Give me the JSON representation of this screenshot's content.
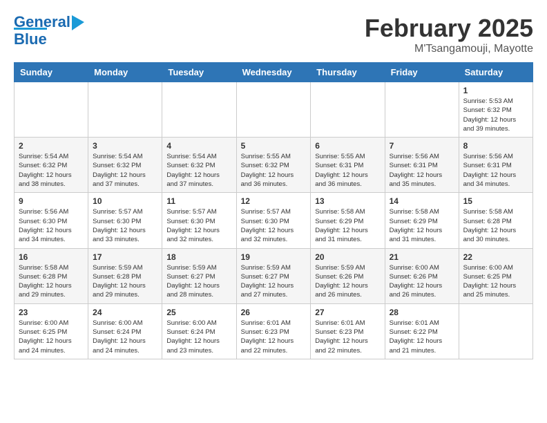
{
  "header": {
    "logo_line1": "General",
    "logo_line2": "Blue",
    "month": "February 2025",
    "location": "M'Tsangamouji, Mayotte"
  },
  "days_of_week": [
    "Sunday",
    "Monday",
    "Tuesday",
    "Wednesday",
    "Thursday",
    "Friday",
    "Saturday"
  ],
  "weeks": [
    {
      "days": [
        {
          "number": "",
          "info": ""
        },
        {
          "number": "",
          "info": ""
        },
        {
          "number": "",
          "info": ""
        },
        {
          "number": "",
          "info": ""
        },
        {
          "number": "",
          "info": ""
        },
        {
          "number": "",
          "info": ""
        },
        {
          "number": "1",
          "info": "Sunrise: 5:53 AM\nSunset: 6:32 PM\nDaylight: 12 hours and 39 minutes."
        }
      ]
    },
    {
      "days": [
        {
          "number": "2",
          "info": "Sunrise: 5:54 AM\nSunset: 6:32 PM\nDaylight: 12 hours and 38 minutes."
        },
        {
          "number": "3",
          "info": "Sunrise: 5:54 AM\nSunset: 6:32 PM\nDaylight: 12 hours and 37 minutes."
        },
        {
          "number": "4",
          "info": "Sunrise: 5:54 AM\nSunset: 6:32 PM\nDaylight: 12 hours and 37 minutes."
        },
        {
          "number": "5",
          "info": "Sunrise: 5:55 AM\nSunset: 6:32 PM\nDaylight: 12 hours and 36 minutes."
        },
        {
          "number": "6",
          "info": "Sunrise: 5:55 AM\nSunset: 6:31 PM\nDaylight: 12 hours and 36 minutes."
        },
        {
          "number": "7",
          "info": "Sunrise: 5:56 AM\nSunset: 6:31 PM\nDaylight: 12 hours and 35 minutes."
        },
        {
          "number": "8",
          "info": "Sunrise: 5:56 AM\nSunset: 6:31 PM\nDaylight: 12 hours and 34 minutes."
        }
      ]
    },
    {
      "days": [
        {
          "number": "9",
          "info": "Sunrise: 5:56 AM\nSunset: 6:30 PM\nDaylight: 12 hours and 34 minutes."
        },
        {
          "number": "10",
          "info": "Sunrise: 5:57 AM\nSunset: 6:30 PM\nDaylight: 12 hours and 33 minutes."
        },
        {
          "number": "11",
          "info": "Sunrise: 5:57 AM\nSunset: 6:30 PM\nDaylight: 12 hours and 32 minutes."
        },
        {
          "number": "12",
          "info": "Sunrise: 5:57 AM\nSunset: 6:30 PM\nDaylight: 12 hours and 32 minutes."
        },
        {
          "number": "13",
          "info": "Sunrise: 5:58 AM\nSunset: 6:29 PM\nDaylight: 12 hours and 31 minutes."
        },
        {
          "number": "14",
          "info": "Sunrise: 5:58 AM\nSunset: 6:29 PM\nDaylight: 12 hours and 31 minutes."
        },
        {
          "number": "15",
          "info": "Sunrise: 5:58 AM\nSunset: 6:28 PM\nDaylight: 12 hours and 30 minutes."
        }
      ]
    },
    {
      "days": [
        {
          "number": "16",
          "info": "Sunrise: 5:58 AM\nSunset: 6:28 PM\nDaylight: 12 hours and 29 minutes."
        },
        {
          "number": "17",
          "info": "Sunrise: 5:59 AM\nSunset: 6:28 PM\nDaylight: 12 hours and 29 minutes."
        },
        {
          "number": "18",
          "info": "Sunrise: 5:59 AM\nSunset: 6:27 PM\nDaylight: 12 hours and 28 minutes."
        },
        {
          "number": "19",
          "info": "Sunrise: 5:59 AM\nSunset: 6:27 PM\nDaylight: 12 hours and 27 minutes."
        },
        {
          "number": "20",
          "info": "Sunrise: 5:59 AM\nSunset: 6:26 PM\nDaylight: 12 hours and 26 minutes."
        },
        {
          "number": "21",
          "info": "Sunrise: 6:00 AM\nSunset: 6:26 PM\nDaylight: 12 hours and 26 minutes."
        },
        {
          "number": "22",
          "info": "Sunrise: 6:00 AM\nSunset: 6:25 PM\nDaylight: 12 hours and 25 minutes."
        }
      ]
    },
    {
      "days": [
        {
          "number": "23",
          "info": "Sunrise: 6:00 AM\nSunset: 6:25 PM\nDaylight: 12 hours and 24 minutes."
        },
        {
          "number": "24",
          "info": "Sunrise: 6:00 AM\nSunset: 6:24 PM\nDaylight: 12 hours and 24 minutes."
        },
        {
          "number": "25",
          "info": "Sunrise: 6:00 AM\nSunset: 6:24 PM\nDaylight: 12 hours and 23 minutes."
        },
        {
          "number": "26",
          "info": "Sunrise: 6:01 AM\nSunset: 6:23 PM\nDaylight: 12 hours and 22 minutes."
        },
        {
          "number": "27",
          "info": "Sunrise: 6:01 AM\nSunset: 6:23 PM\nDaylight: 12 hours and 22 minutes."
        },
        {
          "number": "28",
          "info": "Sunrise: 6:01 AM\nSunset: 6:22 PM\nDaylight: 12 hours and 21 minutes."
        },
        {
          "number": "",
          "info": ""
        }
      ]
    }
  ]
}
